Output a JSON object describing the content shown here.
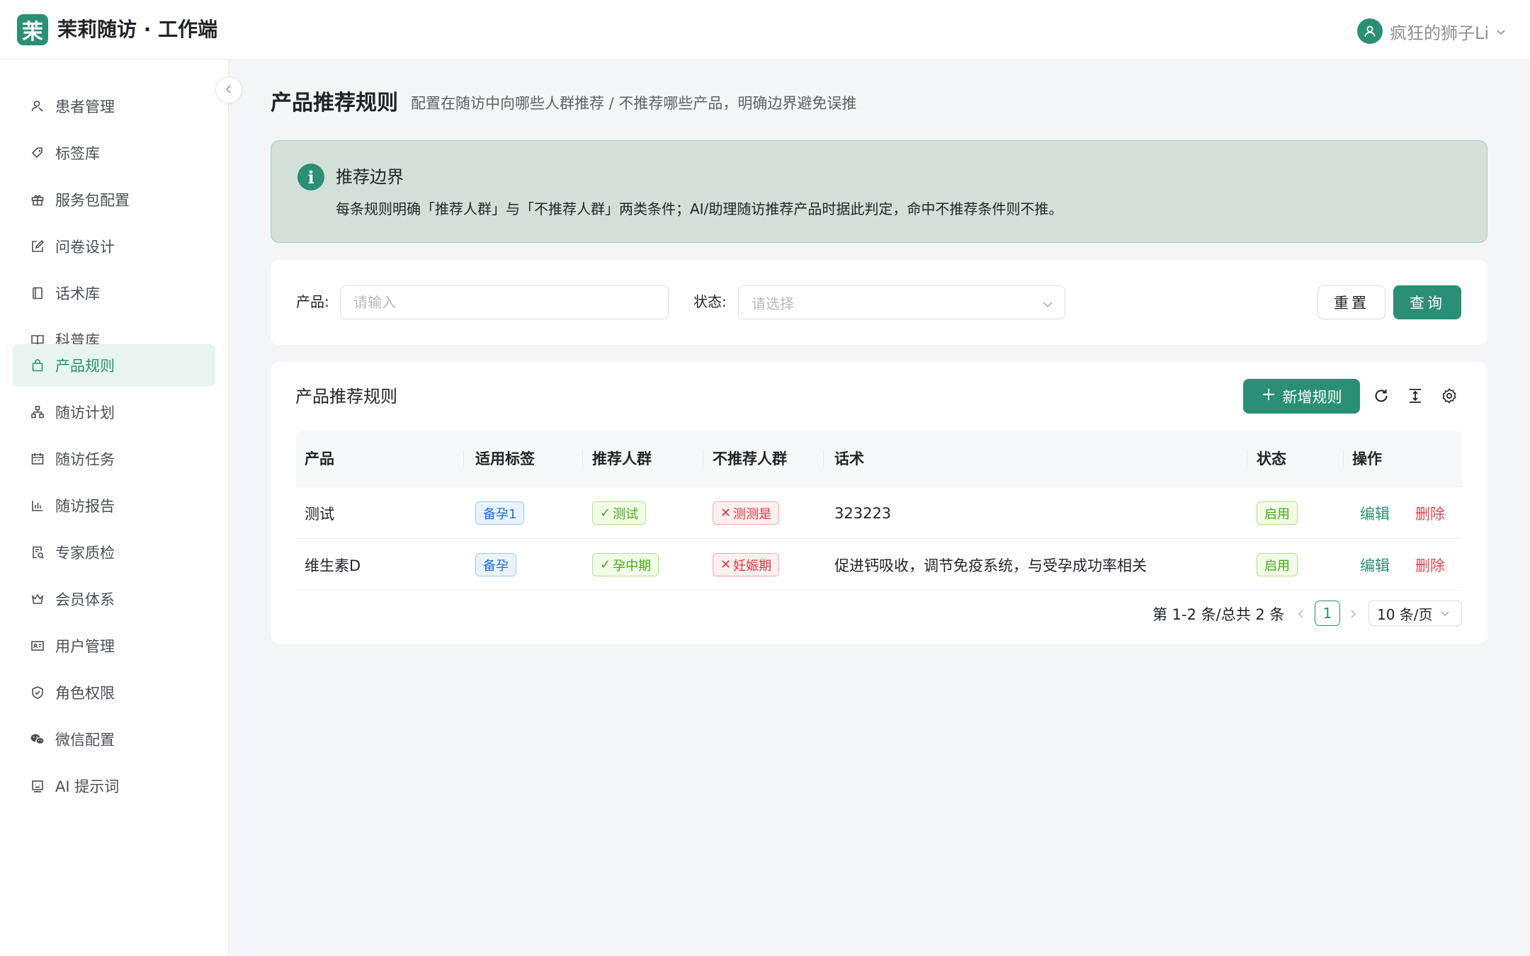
{
  "header": {
    "logo_char": "茉",
    "app_title": "茉莉随访 · 工作端",
    "user_name": "疯狂的狮子Li"
  },
  "sidebar": {
    "items": [
      {
        "label": "患者管理",
        "icon": "user-icon"
      },
      {
        "label": "标签库",
        "icon": "tag-icon"
      },
      {
        "label": "服务包配置",
        "icon": "gift-icon"
      },
      {
        "label": "问卷设计",
        "icon": "edit-icon"
      },
      {
        "label": "话术库",
        "icon": "book-icon"
      },
      {
        "label": "科普库",
        "icon": "read-icon"
      },
      {
        "label": "产品规则",
        "icon": "bag-icon",
        "active": true
      },
      {
        "label": "随访计划",
        "icon": "hierarchy-icon"
      },
      {
        "label": "随访任务",
        "icon": "calendar-icon"
      },
      {
        "label": "随访报告",
        "icon": "bar-chart-icon"
      },
      {
        "label": "专家质检",
        "icon": "audit-icon"
      },
      {
        "label": "会员体系",
        "icon": "crown-icon"
      },
      {
        "label": "用户管理",
        "icon": "id-card-icon"
      },
      {
        "label": "角色权限",
        "icon": "shield-icon"
      },
      {
        "label": "微信配置",
        "icon": "wechat-icon"
      },
      {
        "label": "AI 提示词",
        "icon": "robot-icon"
      }
    ]
  },
  "page": {
    "title": "产品推荐规则",
    "subtitle": "配置在随访中向哪些人群推荐 / 不推荐哪些产品，明确边界避免误推"
  },
  "info": {
    "title": "推荐边界",
    "text": "每条规则明确「推荐人群」与「不推荐人群」两类条件；AI/助理随访推荐产品时据此判定，命中不推荐条件则不推。"
  },
  "filter": {
    "product_label": "产品:",
    "product_placeholder": "请输入",
    "status_label": "状态:",
    "status_placeholder": "请选择",
    "reset_label": "重置",
    "query_label": "查询"
  },
  "table": {
    "title": "产品推荐规则",
    "add_label": "新增规则",
    "columns": [
      "产品",
      "适用标签",
      "推荐人群",
      "不推荐人群",
      "话术",
      "状态",
      "操作"
    ],
    "rows": [
      {
        "product": "测试",
        "tag": "备孕1",
        "recommend": "测试",
        "not_recommend": "测测是",
        "script": "323223",
        "status": "启用",
        "edit": "编辑",
        "delete": "删除"
      },
      {
        "product": "维生素D",
        "tag": "备孕",
        "recommend": "孕中期",
        "not_recommend": "妊娠期",
        "script": "促进钙吸收，调节免疫系统，与受孕成功率相关",
        "status": "启用",
        "edit": "编辑",
        "delete": "删除"
      }
    ],
    "pagination": {
      "summary": "第 1-2 条/总共 2 条",
      "current_page": "1",
      "page_size": "10 条/页"
    }
  },
  "colors": {
    "brand": "#2a8f74",
    "danger": "#e5484d"
  }
}
